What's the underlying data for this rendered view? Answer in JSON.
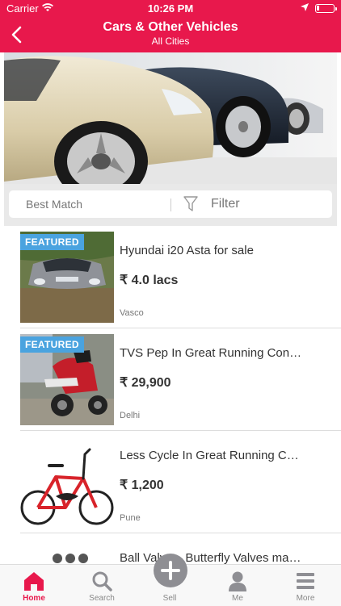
{
  "status_bar": {
    "carrier": "Carrier",
    "time": "10:26 PM"
  },
  "nav": {
    "title": "Cars & Other Vehicles",
    "subtitle": "All Cities"
  },
  "sort_bar": {
    "sort_label": "Best Match",
    "filter_label": "Filter"
  },
  "listings": [
    {
      "badge": "FEATURED",
      "title": "Hyundai i20 Asta for sale",
      "price": "₹ 4.0 lacs",
      "city": "Vasco"
    },
    {
      "badge": "FEATURED",
      "title": "TVS Pep In Great Running Con…",
      "price": "₹ 29,900",
      "city": "Delhi"
    },
    {
      "title": "Less Cycle In Great Running C…",
      "price": "₹ 1,200",
      "city": "Pune"
    },
    {
      "title": "Ball Valves, Butterfly Valves ma…"
    }
  ],
  "tab_bar": {
    "tabs": [
      {
        "label": "Home",
        "icon": "home-icon",
        "active": true
      },
      {
        "label": "Search",
        "icon": "search-icon",
        "active": false
      },
      {
        "label": "Sell",
        "icon": "plus-icon",
        "active": false
      },
      {
        "label": "Me",
        "icon": "person-icon",
        "active": false
      },
      {
        "label": "More",
        "icon": "menu-icon",
        "active": false
      }
    ]
  },
  "colors": {
    "brand": "#e8184c",
    "badge": "#4aa3df"
  }
}
